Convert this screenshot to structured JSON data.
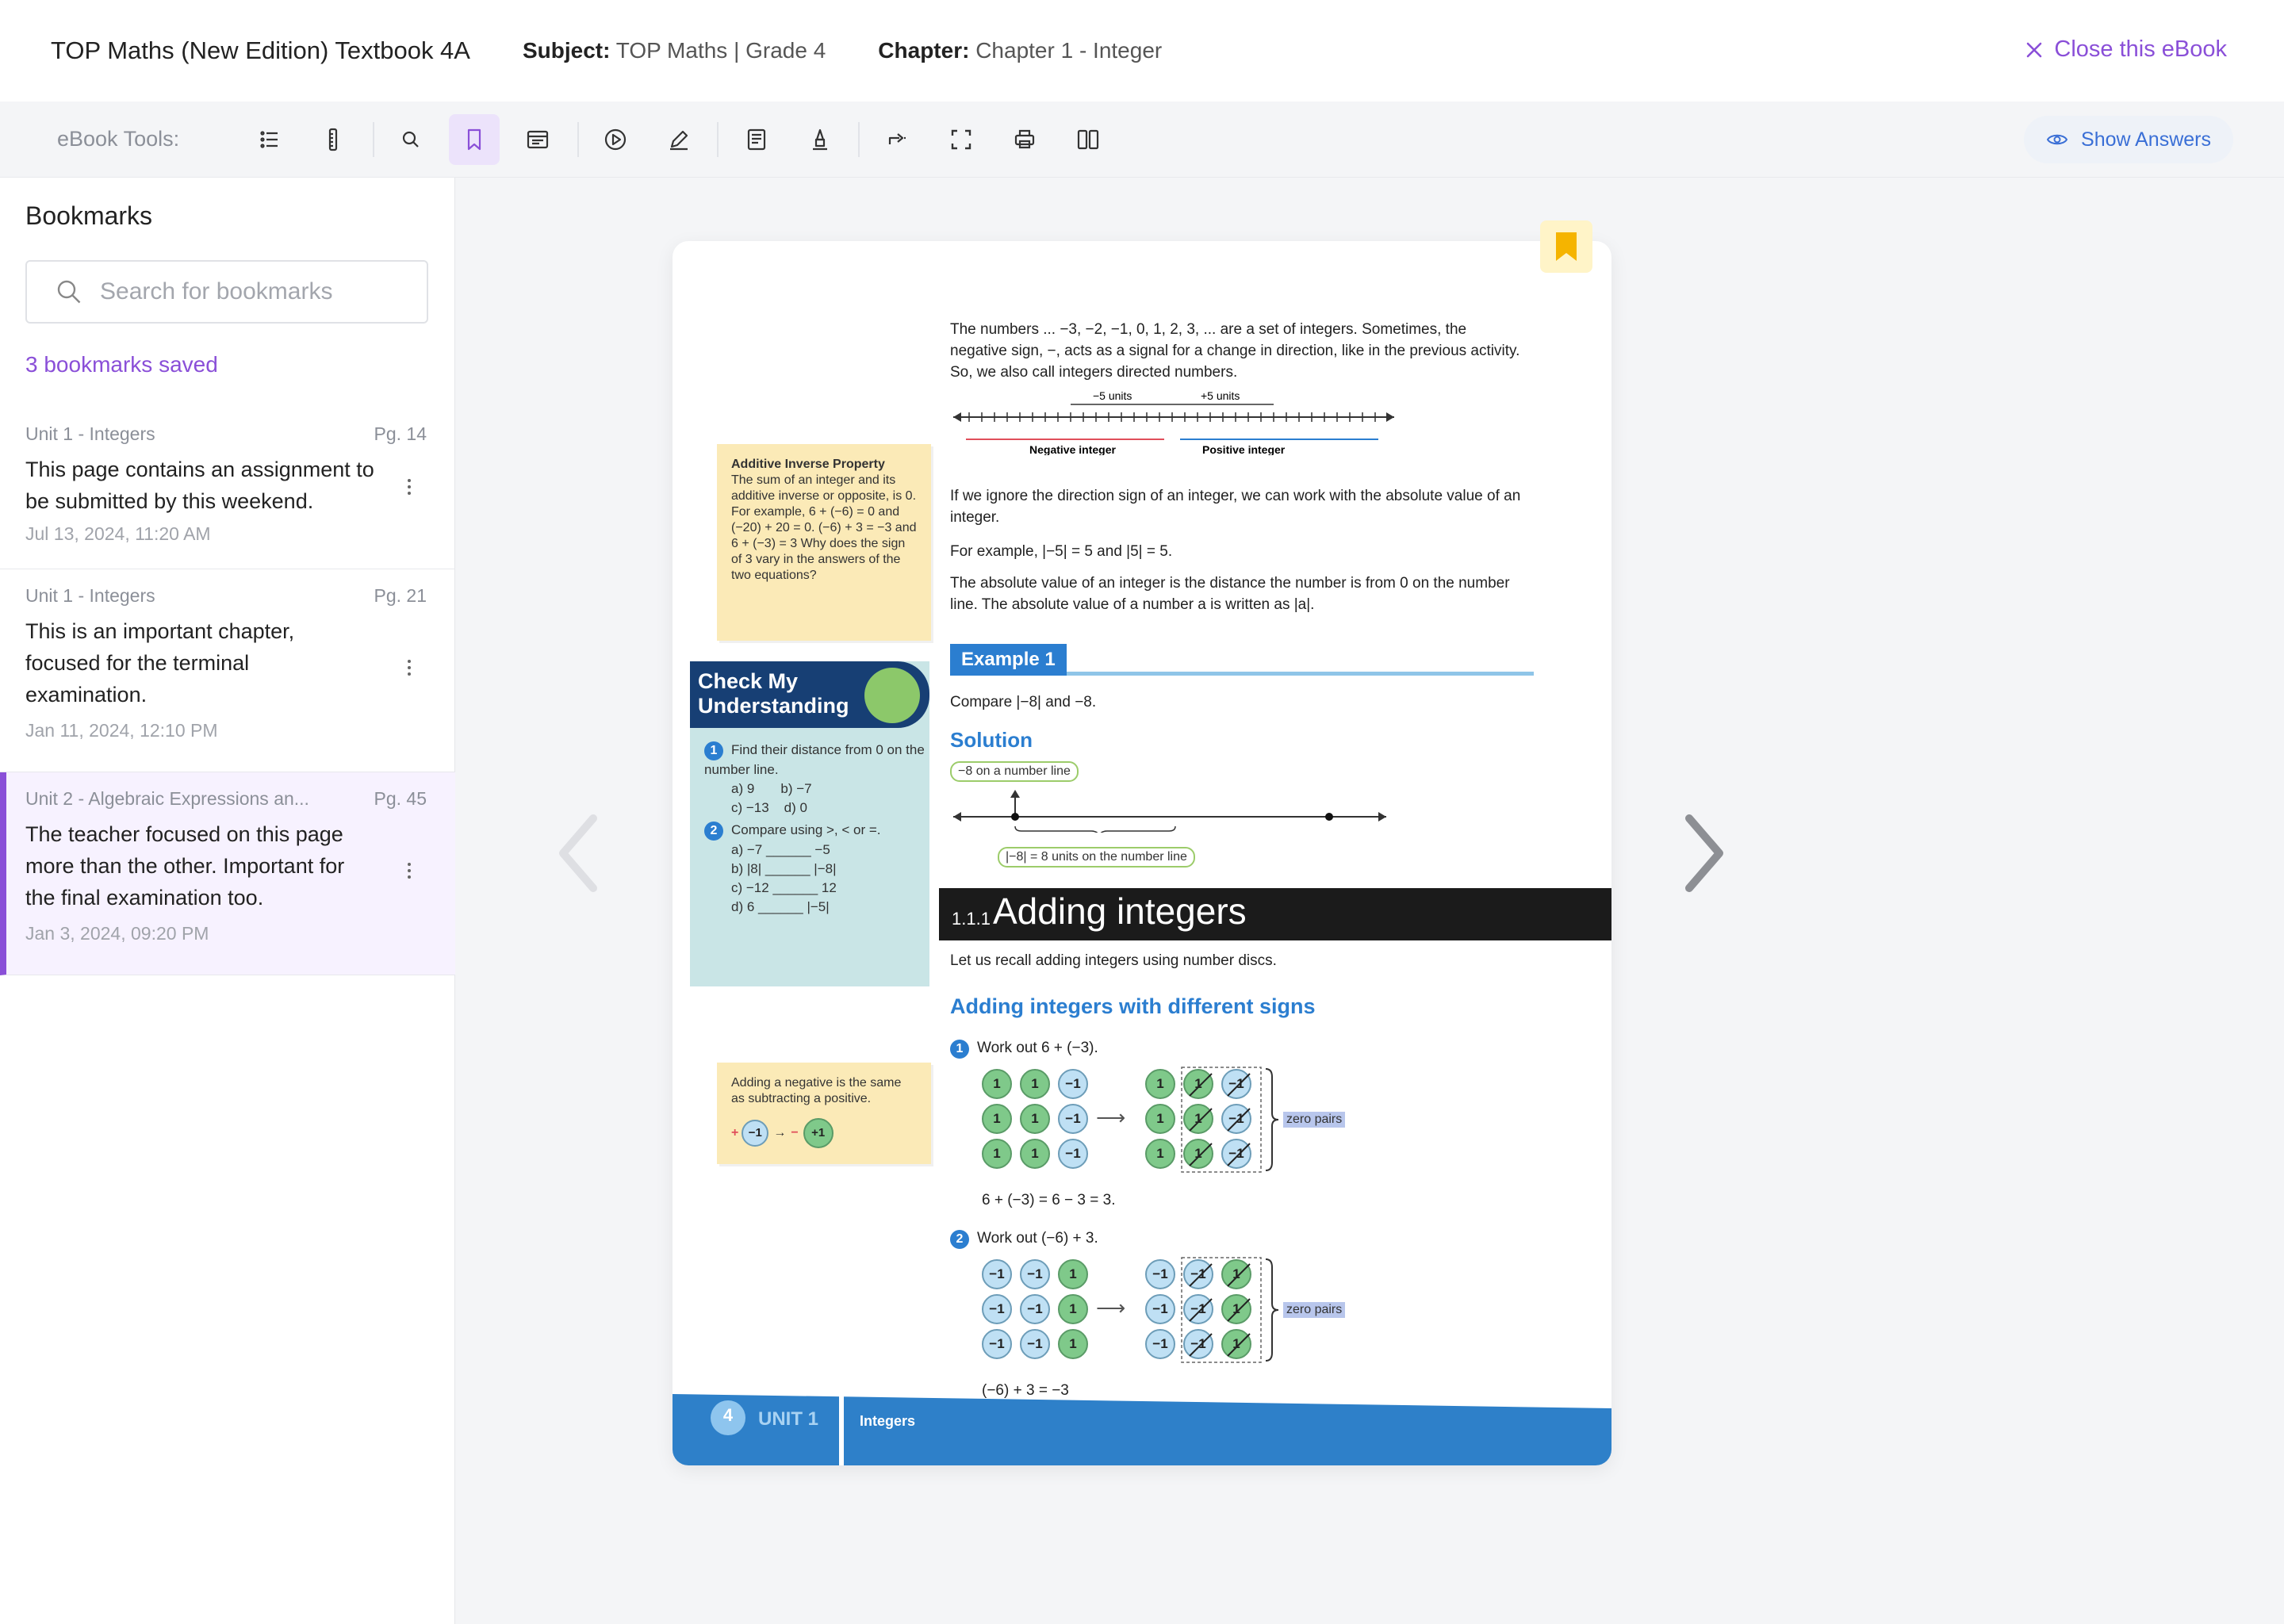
{
  "header": {
    "book_title": "TOP Maths (New Edition) Textbook 4A",
    "subject_label": "Subject:",
    "subject_value": "TOP Maths | Grade 4",
    "chapter_label": "Chapter:",
    "chapter_value": "Chapter 1 - Integer",
    "close_label": "Close this eBook"
  },
  "toolbar": {
    "label": "eBook Tools:",
    "show_answers": "Show Answers",
    "tools": [
      "list-icon",
      "ruler-icon",
      "search-icon",
      "bookmark-icon",
      "notes-icon",
      "play-icon",
      "pen-icon",
      "worksheet-icon",
      "highlighter-icon",
      "share-icon",
      "fullscreen-icon",
      "print-icon",
      "two-page-icon"
    ],
    "active_tool": "bookmark-icon",
    "accent": "#8a4fd8"
  },
  "sidebar": {
    "title": "Bookmarks",
    "search_placeholder": "Search for bookmarks",
    "count": "3 bookmarks saved",
    "bookmarks": [
      {
        "unit": "Unit 1 - Integers",
        "page": "Pg. 14",
        "note": "This page contains an assignment to be submitted by this weekend.",
        "date": "Jul 13, 2024, 11:20 AM"
      },
      {
        "unit": "Unit 1 - Integers",
        "page": "Pg. 21",
        "note": "This is an important chapter, focused for the terminal examination.",
        "date": "Jan 11, 2024, 12:10 PM"
      },
      {
        "unit": "Unit 2 - Algebraic Expressions an...",
        "page": "Pg. 45",
        "note": "The teacher focused on this page more than the other. Important for the final examination too.",
        "date": "Jan 3, 2024, 09:20 PM"
      }
    ]
  },
  "page": {
    "intro": "The numbers ... −3, −2, −1, 0, 1, 2, 3, ... are a set of integers. Sometimes, the negative sign, −, acts as a signal for a change in direction, like in the previous activity. So, we also call integers directed numbers.",
    "minus5": "−5 units",
    "plus5": "+5 units",
    "neg_int": "Negative integer",
    "pos_int": "Positive integer",
    "abs_1": "If we ignore the direction sign of an integer, we can work with the absolute value of an integer.",
    "abs_2": "For example, |−5| = 5 and |5| = 5.",
    "abs_3": "The absolute value of an integer is the distance the number is from 0 on the number line. The absolute value of a number a is written as |a|.",
    "aip_title": "Additive Inverse Property",
    "aip_text": "The sum of an integer and its additive inverse or opposite, is 0. For example, 6 + (−6) = 0 and (−20) + 20 = 0. (−6) + 3 = −3 and 6 + (−3) = 3 Why does the sign of 3 vary in the answers of the two equations?",
    "cmu_title": "Check My Understanding",
    "cmu_q1": "Find their distance from 0 on the number line.",
    "cmu_q1a": "a) 9",
    "cmu_q1b": "b) −7",
    "cmu_q1c": "c) −13",
    "cmu_q1d": "d) 0",
    "cmu_q2": "Compare using >, < or =.",
    "cmu_q2a": "a) −7 ______ −5",
    "cmu_q2b": "b) |8| ______ |−8|",
    "cmu_q2c": "c) −12 ______ 12",
    "cmu_q2d": "d) 6 ______ |−5|",
    "example_label": "Example 1",
    "example_text": "Compare |−8| and −8.",
    "solution": "Solution",
    "tag_on_line": "−8 on a number line",
    "tag_units": "|−8| = 8 units on the number line",
    "section_num": "1.1.1",
    "section_title": "Adding integers",
    "recall": "Let us recall adding integers using number discs.",
    "sub_heading": "Adding integers with different signs",
    "tip": "Adding a negative is the same as subtracting a positive.",
    "tip_plus": "+",
    "tip_minus_one": "−1",
    "tip_minus": "−",
    "tip_plus_one": "+1",
    "step1": "Work out 6 + (−3).",
    "step1_result": "6 + (−3) = 6 − 3 = 3.",
    "step2": "Work out (−6) + 3.",
    "step2_result": "(−6) + 3 = −3",
    "zero_pairs": "zero pairs",
    "disc_one": "1",
    "disc_neg": "−1",
    "footer_num": "4",
    "footer_unit": "UNIT 1",
    "footer_topic": "Integers"
  }
}
